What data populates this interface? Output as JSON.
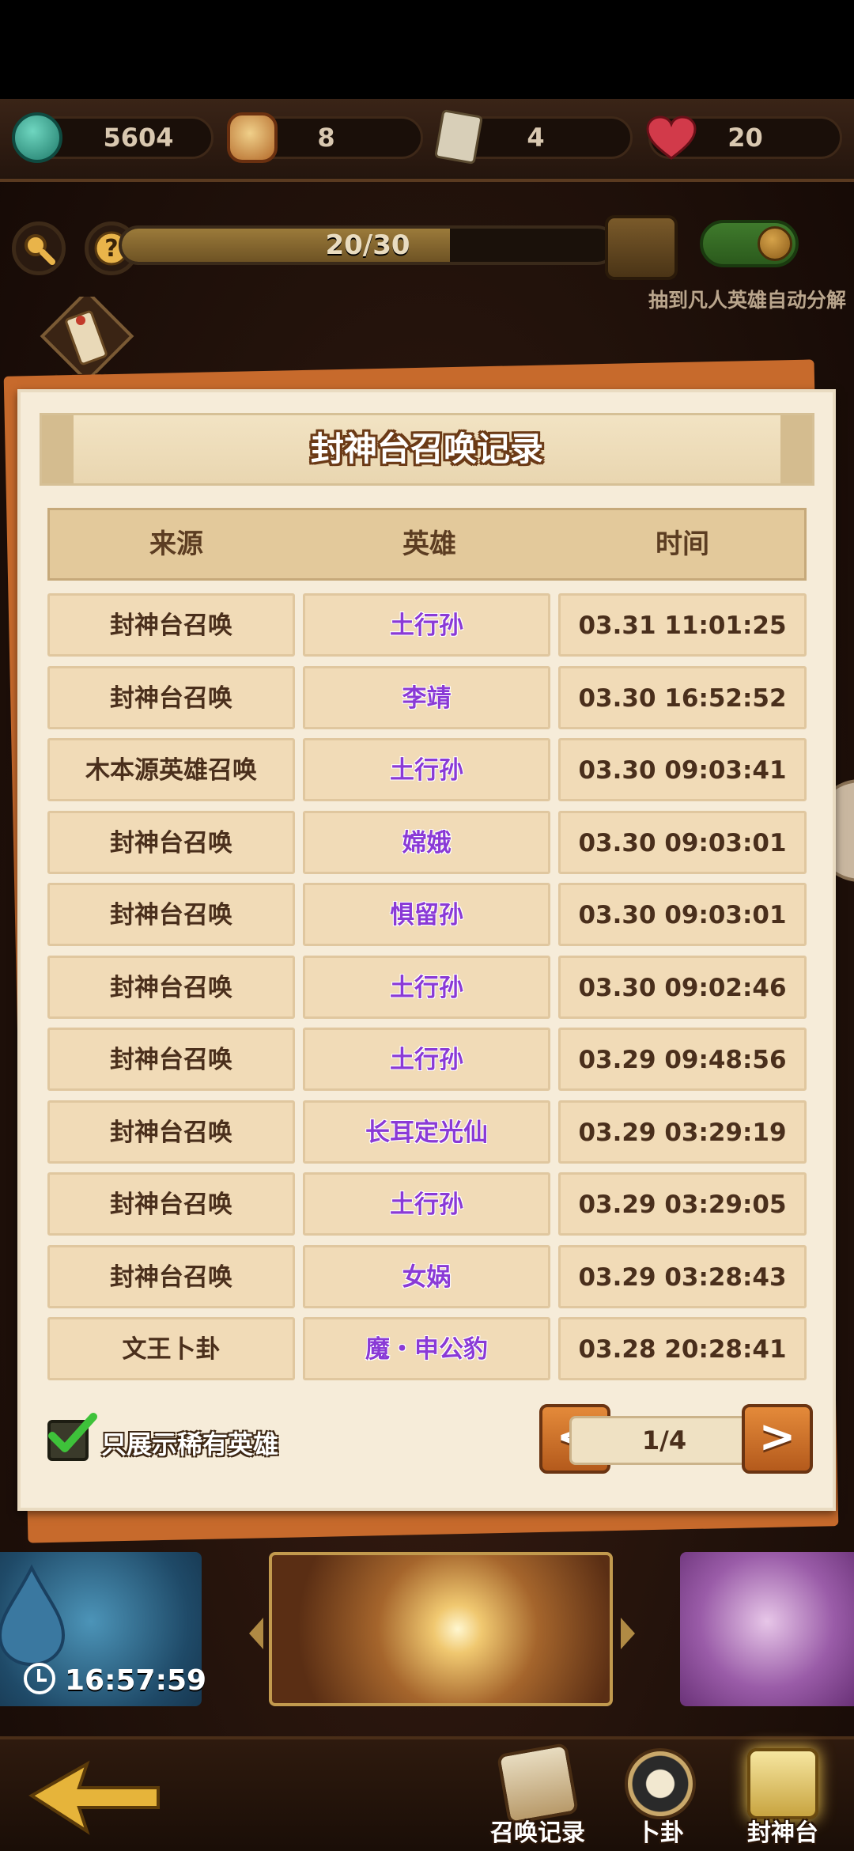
{
  "resources": [
    {
      "icon": "jade-coin-icon",
      "value": "5604"
    },
    {
      "icon": "lucky-cat-icon",
      "value": "8"
    },
    {
      "icon": "summon-ticket-icon",
      "value": "4"
    },
    {
      "icon": "heart-icon",
      "value": "20"
    }
  ],
  "progress": {
    "text": "20/30",
    "fraction": 0.667
  },
  "auto_decompose": {
    "label": "抽到凡人英雄自动分解",
    "enabled": true
  },
  "wish_tag": {
    "label": "心愿签"
  },
  "panel": {
    "title": "封神台召唤记录",
    "columns": [
      "来源",
      "英雄",
      "时间"
    ],
    "rows": [
      {
        "source": "封神台召唤",
        "hero": "土行孙",
        "time": "03.31 11:01:25"
      },
      {
        "source": "封神台召唤",
        "hero": "李靖",
        "time": "03.30 16:52:52"
      },
      {
        "source": "木本源英雄召唤",
        "hero": "土行孙",
        "time": "03.30 09:03:41"
      },
      {
        "source": "封神台召唤",
        "hero": "嫦娥",
        "time": "03.30 09:03:01"
      },
      {
        "source": "封神台召唤",
        "hero": "惧留孙",
        "time": "03.30 09:03:01"
      },
      {
        "source": "封神台召唤",
        "hero": "土行孙",
        "time": "03.30 09:02:46"
      },
      {
        "source": "封神台召唤",
        "hero": "土行孙",
        "time": "03.29 09:48:56"
      },
      {
        "source": "封神台召唤",
        "hero": "长耳定光仙",
        "time": "03.29 03:29:19"
      },
      {
        "source": "封神台召唤",
        "hero": "土行孙",
        "time": "03.29 03:29:05"
      },
      {
        "source": "封神台召唤",
        "hero": "女娲",
        "time": "03.29 03:28:43"
      },
      {
        "source": "文王卜卦",
        "hero": "魔・申公豹",
        "time": "03.28 20:28:41"
      }
    ],
    "filter_label": "只展示稀有英雄",
    "filter_checked": true,
    "page_text": "1/4",
    "prev_label": "<",
    "next_label": ">"
  },
  "timer": "16:57:59",
  "nav": [
    {
      "label": "召唤记录",
      "icon": "summon-record-scroll-icon"
    },
    {
      "label": "卜卦",
      "icon": "bagua-icon"
    },
    {
      "label": "封神台",
      "icon": "fengshen-scroll-icon"
    }
  ],
  "colors": {
    "hero_text": "#8a3ad6",
    "panel_bg": "#f6ecd9",
    "accent_orange": "#c76a2c"
  }
}
